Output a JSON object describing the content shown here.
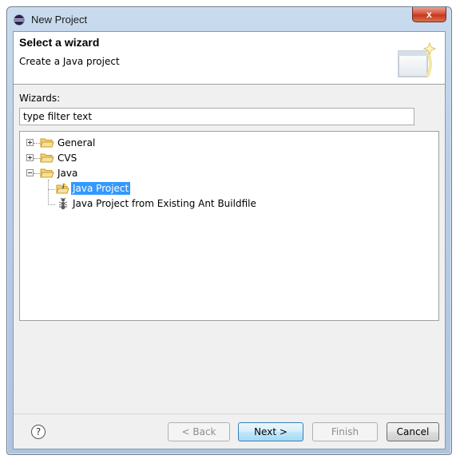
{
  "window": {
    "title": "New Project",
    "close_label": "x"
  },
  "header": {
    "title": "Select a wizard",
    "description": "Create a Java project"
  },
  "wizards": {
    "label": "Wizards:",
    "filter_value": "type filter text"
  },
  "tree": {
    "items": [
      {
        "label": "General",
        "type": "folder",
        "expanded": false
      },
      {
        "label": "CVS",
        "type": "folder",
        "expanded": false
      },
      {
        "label": "Java",
        "type": "folder",
        "expanded": true
      },
      {
        "label": "Java Project",
        "type": "java-project",
        "selected": true
      },
      {
        "label": "Java Project from Existing Ant Buildfile",
        "type": "ant",
        "selected": false
      }
    ]
  },
  "buttons": {
    "help": "?",
    "back": "< Back",
    "next": "Next >",
    "finish": "Finish",
    "cancel": "Cancel"
  },
  "colors": {
    "selection": "#3399ff",
    "folder": "#e8b83c",
    "close": "#c4381f"
  }
}
